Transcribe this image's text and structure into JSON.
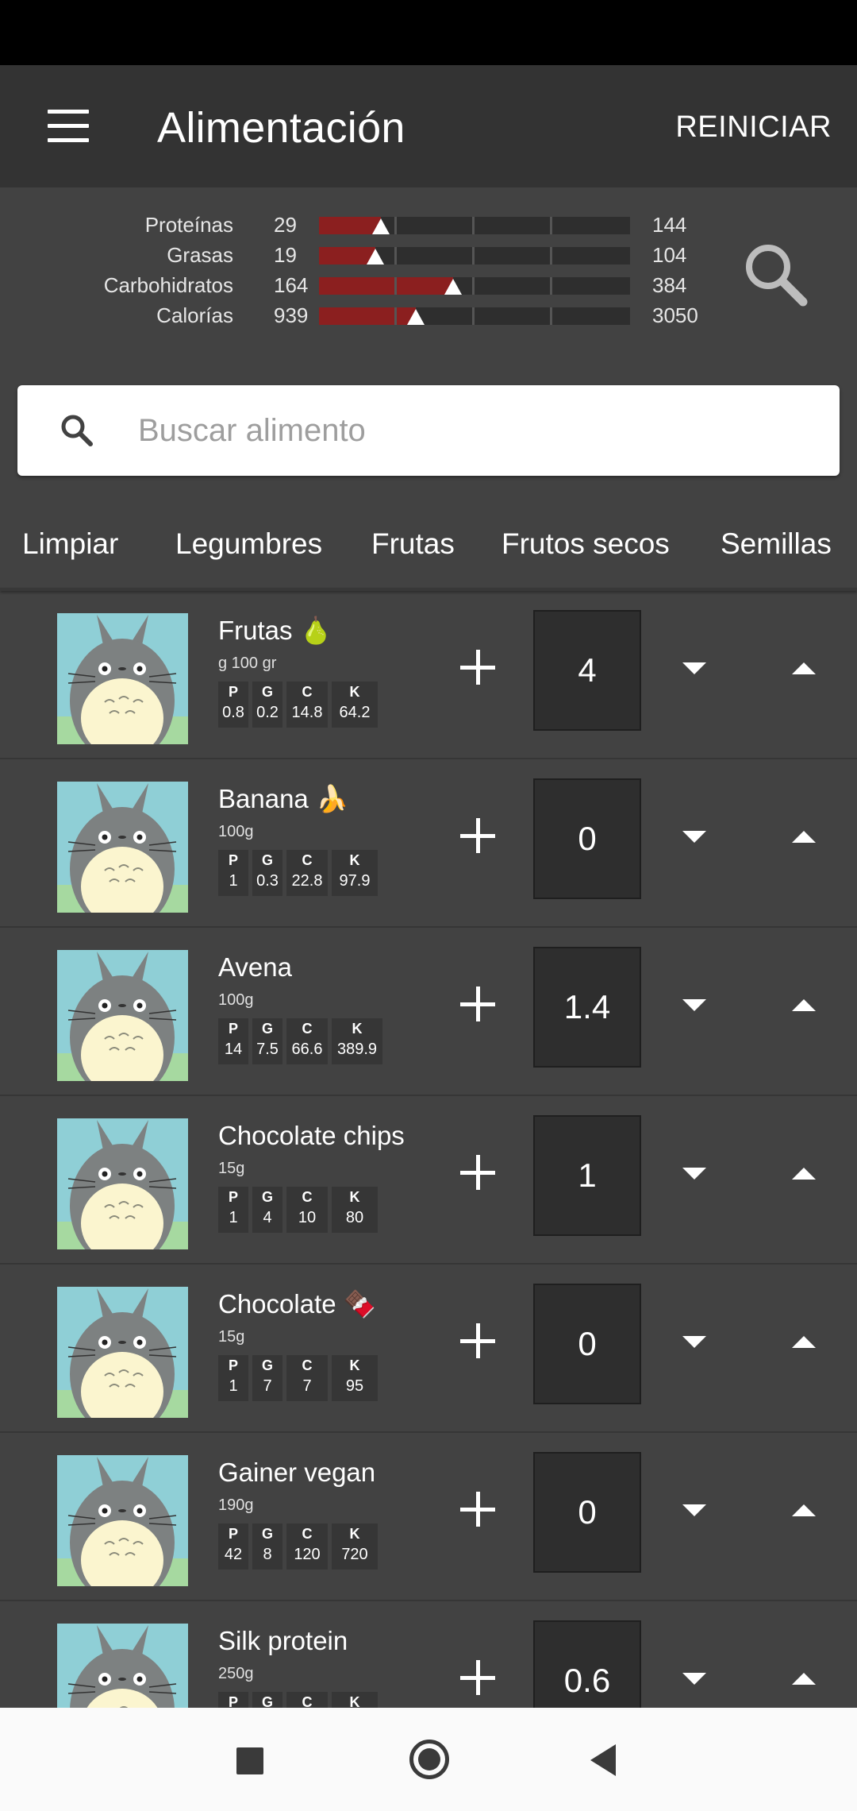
{
  "app_bar": {
    "title": "Alimentación",
    "reset_label": "REINICIAR"
  },
  "summary": {
    "rows": [
      {
        "label": "Proteínas",
        "value": "29",
        "target": "144",
        "progress": 0.2
      },
      {
        "label": "Grasas",
        "value": "19",
        "target": "104",
        "progress": 0.18
      },
      {
        "label": "Carbohidratos",
        "value": "164",
        "target": "384",
        "progress": 0.43
      },
      {
        "label": "Calorías",
        "value": "939",
        "target": "3050",
        "progress": 0.31
      }
    ],
    "bar_color": "#8b1f1f"
  },
  "search": {
    "placeholder": "Buscar alimento"
  },
  "chips": [
    "Limpiar",
    "Legumbres",
    "Frutas",
    "Frutos secos",
    "Semillas"
  ],
  "foods": [
    {
      "name": "Frutas 🍐",
      "portion": "g 100 gr",
      "P": "0.8",
      "G": "0.2",
      "C": "14.8",
      "K": "64.2",
      "qty": "4"
    },
    {
      "name": "Banana 🍌",
      "portion": "100g",
      "P": "1",
      "G": "0.3",
      "C": "22.8",
      "K": "97.9",
      "qty": "0"
    },
    {
      "name": "Avena",
      "portion": "100g",
      "P": "14",
      "G": "7.5",
      "C": "66.6",
      "K": "389.9",
      "qty": "1.4"
    },
    {
      "name": "Chocolate chips",
      "portion": "15g",
      "P": "1",
      "G": "4",
      "C": "10",
      "K": "80",
      "qty": "1"
    },
    {
      "name": "Chocolate 🍫",
      "portion": "15g",
      "P": "1",
      "G": "7",
      "C": "7",
      "K": "95",
      "qty": "0"
    },
    {
      "name": "Gainer vegan",
      "portion": "190g",
      "P": "42",
      "G": "8",
      "C": "120",
      "K": "720",
      "qty": "0"
    },
    {
      "name": "Silk protein",
      "portion": "250g",
      "P": "",
      "G": "",
      "C": "",
      "K": "",
      "qty": "0.6"
    }
  ],
  "macro_keys": {
    "P": "P",
    "G": "G",
    "C": "C",
    "K": "K"
  },
  "icons": {
    "menu": "menu-icon",
    "search": "search-icon",
    "add": "plus-icon",
    "decrease": "arrow-down-icon",
    "increase": "arrow-up-icon",
    "thumb": "totoro-image"
  }
}
